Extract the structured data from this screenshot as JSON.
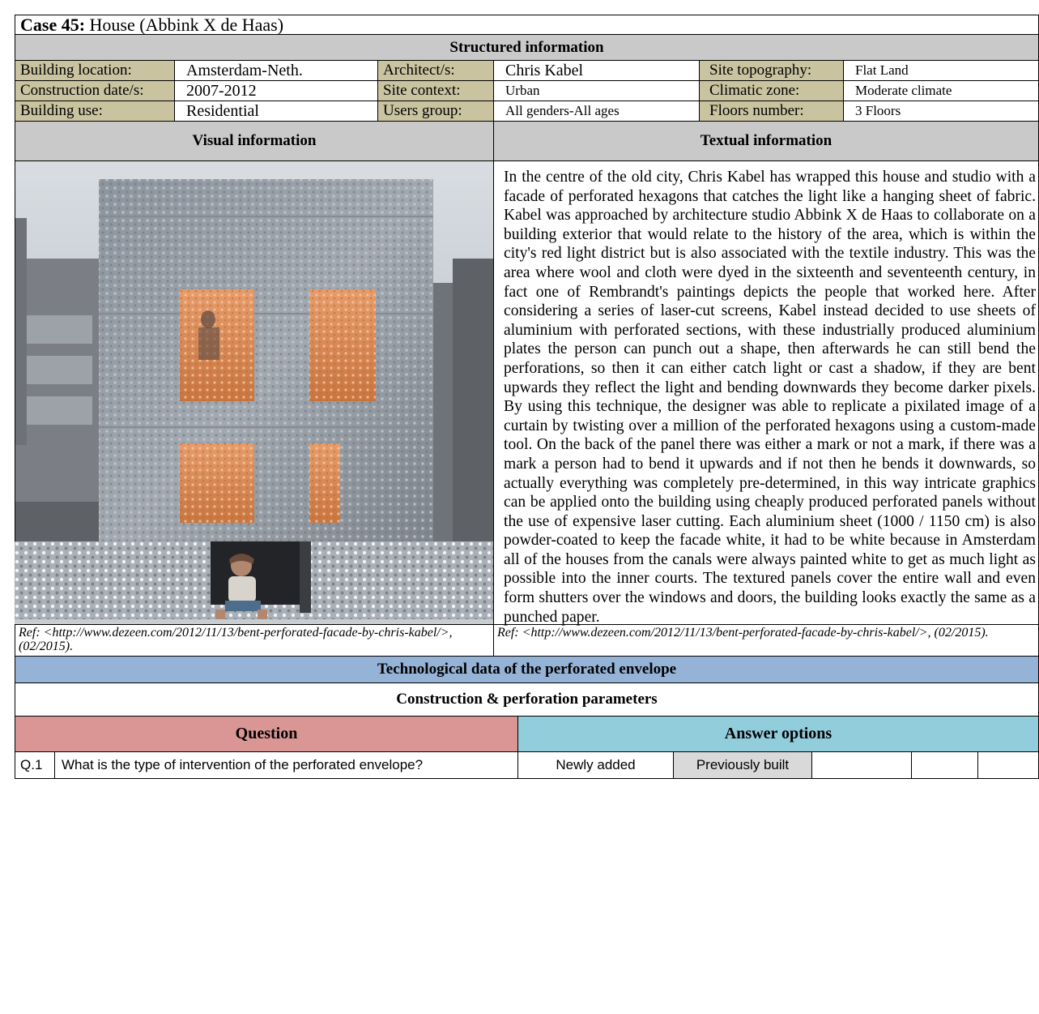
{
  "case": {
    "number_label": "Case 45:",
    "title": " House (Abbink X de Haas)"
  },
  "structured": {
    "header": "Structured information",
    "rows": [
      [
        {
          "label": "Building location:",
          "value": "Amsterdam-Neth."
        },
        {
          "label": "Architect/s:",
          "value": "Chris Kabel"
        },
        {
          "label": "Site topography:",
          "value": "Flat Land"
        }
      ],
      [
        {
          "label": "Construction date/s:",
          "value": "2007-2012"
        },
        {
          "label": "Site context:",
          "value": "Urban"
        },
        {
          "label": "Climatic zone:",
          "value": "Moderate climate"
        }
      ],
      [
        {
          "label": "Building use:",
          "value": "Residential"
        },
        {
          "label": "Users group:",
          "value": "All genders-All ages"
        },
        {
          "label": "Floors number:",
          "value": "3 Floors"
        }
      ]
    ]
  },
  "visual": {
    "header": "Visual information",
    "ref": "Ref: <http://www.dezeen.com/2012/11/13/bent-perforated-facade-by-chris-kabel/>, (02/2015)."
  },
  "textual": {
    "header": "Textual information",
    "body": "In the centre of the old city, Chris Kabel has wrapped this house and studio with a facade of perforated hexagons that catches the light like a hanging sheet of fabric. Kabel was approached by architecture studio Abbink X de Haas to collaborate on a building exterior that would relate to the history of the area, which is within the city's red light district but is also associated with the textile industry. This was the area where wool and cloth were dyed in the sixteenth and seventeenth century, in fact one of Rembrandt's paintings depicts the people that worked here. After considering a series of laser-cut screens, Kabel instead decided to use sheets of aluminium with perforated sections, with these industrially produced aluminium plates the person can punch out a shape, then afterwards he can still bend the perforations, so then it can either catch light or cast a shadow, if they are bent upwards they reflect the light and bending downwards they become darker pixels. By using this technique, the designer was able to replicate a pixilated image of a curtain by twisting over a million of the perforated hexagons using a custom-made tool. On the back of the panel there was either a mark or not a mark, if there was a mark a person had to bend it upwards and if not then he bends it downwards, so actually everything was completely pre-determined, in this way intricate graphics can be applied onto the building using cheaply produced perforated panels without the use of expensive laser cutting. Each aluminium sheet (1000 / 1150 cm) is also powder-coated to keep the facade white, it had to be white because in Amsterdam all of the houses from the canals were always painted white to get as much light as possible into the inner courts. The textured panels cover the entire wall and even form shutters over the windows and doors, the building looks exactly the same as a punched paper.",
    "ref": "Ref: <http://www.dezeen.com/2012/11/13/bent-perforated-facade-by-chris-kabel/>, (02/2015)."
  },
  "tech": {
    "header": "Technological data of the perforated envelope",
    "subheader": "Construction & perforation parameters",
    "question_header": "Question",
    "answer_header": "Answer options",
    "rows": [
      {
        "id": "Q.1",
        "question": "What is the type of intervention of the perforated envelope?",
        "answers": [
          "Newly added",
          "Previously built",
          "",
          "",
          ""
        ]
      }
    ]
  },
  "colors": {
    "header_gray": "#c9c9c9",
    "label_tan": "#c9c3a0",
    "tech_blue": "#95b3d7",
    "question_pink": "#d99694",
    "answer_teal": "#92cddc",
    "selected_gray": "#d9d9d9"
  }
}
